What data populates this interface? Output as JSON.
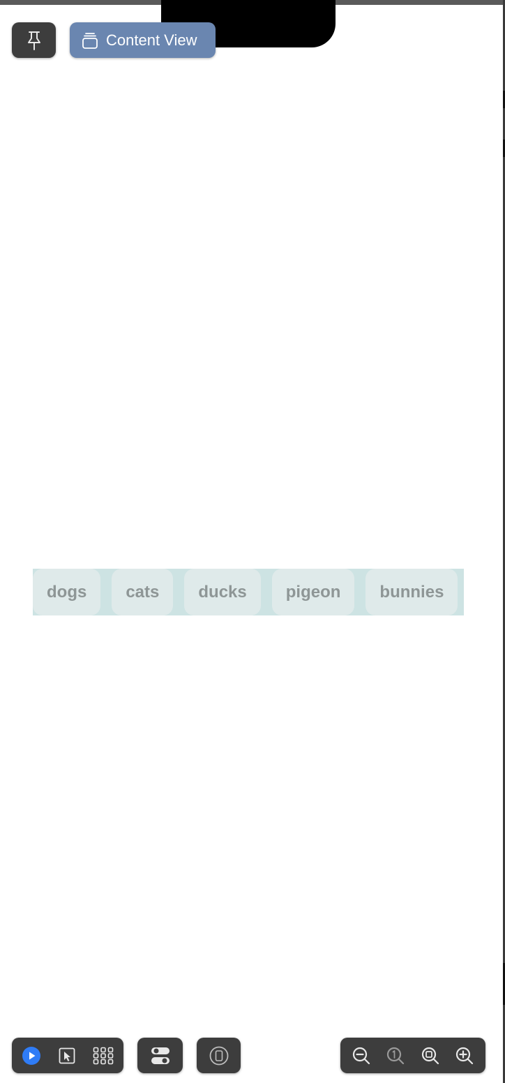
{
  "window": {
    "pin_icon": "pin-icon",
    "content_view_label": "Content View",
    "content_view_icon": "stack-icon"
  },
  "chips": [
    {
      "label": "dogs"
    },
    {
      "label": "cats"
    },
    {
      "label": "ducks"
    },
    {
      "label": "pigeon"
    },
    {
      "label": "bunnies"
    }
  ],
  "bottom_toolbar": {
    "mode_icons": [
      "play-icon",
      "select-cursor-icon",
      "grid-icon"
    ],
    "settings_icon": "toggles-icon",
    "device_icon": "device-icon",
    "zoom_icons": [
      "zoom-out-icon",
      "zoom-actual-size-icon",
      "zoom-to-fit-icon",
      "zoom-in-icon"
    ]
  },
  "colors": {
    "accent_button": "#6a86b0",
    "toolbar_bg": "#3d3d3d",
    "chip_bar_bg": "#cde3e3",
    "chip_bg": "#dfeaea",
    "chip_text": "#8e9696",
    "play_blue": "#2f7cf6"
  }
}
